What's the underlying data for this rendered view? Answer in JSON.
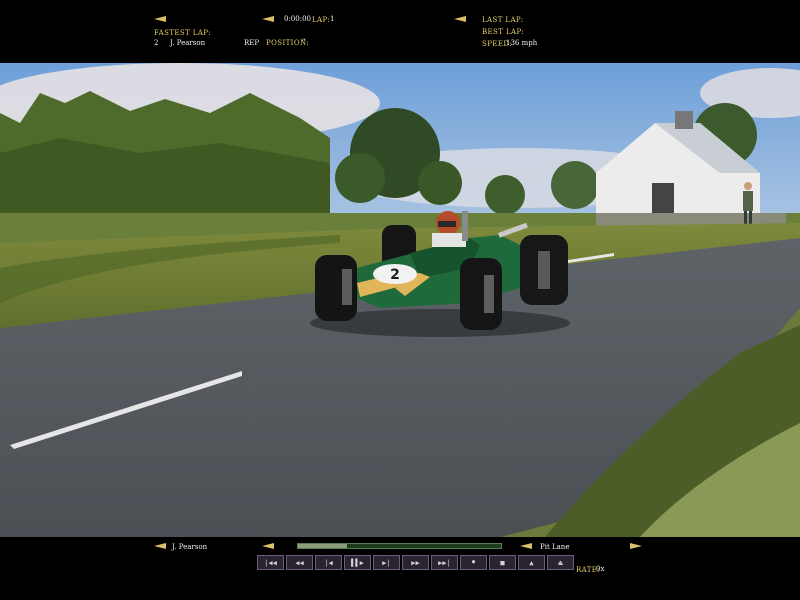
{
  "hud_top": {
    "fastest_lap_label": "Fastest Lap:",
    "fastest_lap_position": "2",
    "fastest_lap_driver": "J. Pearson",
    "rep_label": "REP",
    "position_label": "Position:",
    "position_value": "\"",
    "time": "0:00:00",
    "lap_label": "Lap:",
    "lap_value": "1",
    "last_lap_label": "Last Lap:",
    "best_lap_label": "Best Lap:",
    "speed_label": "Speed:",
    "speed_value": "136 mph"
  },
  "hud_bottom": {
    "driver": "J. Pearson",
    "location": "Pit Lane",
    "rate_label": "Rate:",
    "rate_value": "0x",
    "progress": 0.24,
    "controls": [
      "|◀◀",
      "◀◀",
      "|◀",
      "▌▌▶",
      "▶|",
      "▶▶",
      "▶▶|",
      "⏺",
      "■",
      "▲",
      "⏏"
    ]
  },
  "car": {
    "number": "2"
  },
  "colors": {
    "hud_label": "#e8d36a",
    "car_green": "#1f6a3a",
    "car_yellow": "#e3b55a",
    "sky": "#7aa4d6",
    "road": "#555b61"
  }
}
